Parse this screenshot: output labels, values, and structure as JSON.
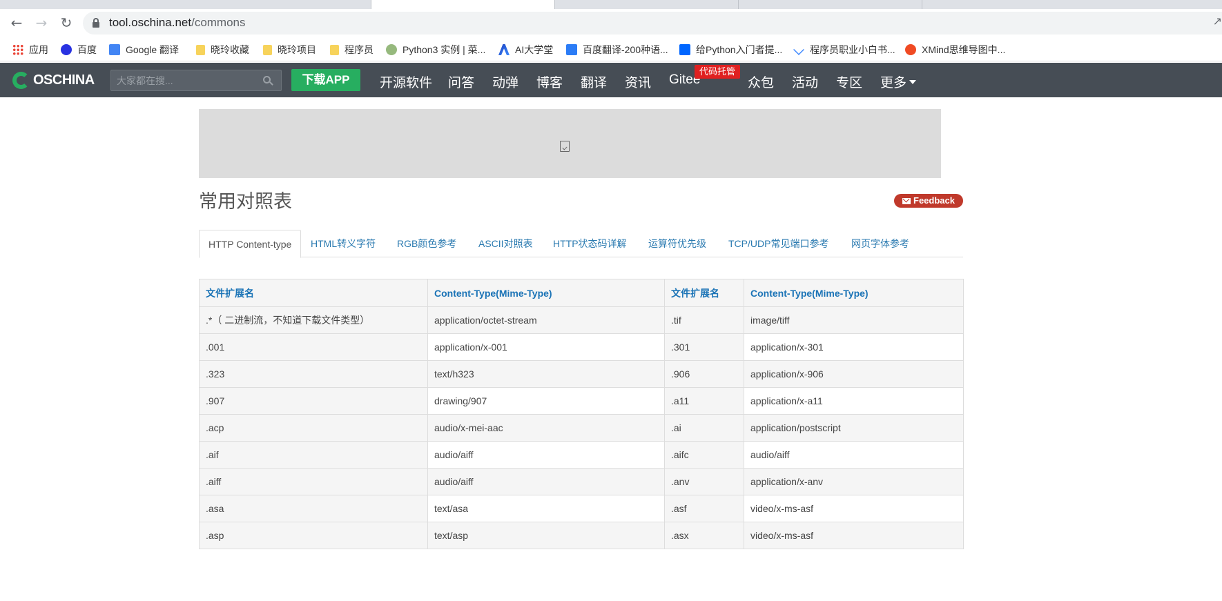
{
  "browser": {
    "address": {
      "host": "tool.oschina.net",
      "path": "/commons"
    },
    "bookmarks": [
      {
        "label": "应用",
        "icon": "apps-grid-icon"
      },
      {
        "label": "百度",
        "icon": "baidu-paw-icon"
      },
      {
        "label": "Google 翻译",
        "icon": "google-translate-icon"
      },
      {
        "label": "晓玲收藏",
        "icon": "folder-icon"
      },
      {
        "label": "晓玲项目",
        "icon": "folder-icon"
      },
      {
        "label": "程序员",
        "icon": "folder-icon"
      },
      {
        "label": "Python3 实例 | 菜...",
        "icon": "runoob-icon"
      },
      {
        "label": "AI大学堂",
        "icon": "ai-icon"
      },
      {
        "label": "百度翻译-200种语...",
        "icon": "baidu-translate-icon"
      },
      {
        "label": "给Python入门者提...",
        "icon": "zhihu-icon"
      },
      {
        "label": "程序员职业小白书...",
        "icon": "layers-icon"
      },
      {
        "label": "XMind思维导图中...",
        "icon": "xmind-icon"
      }
    ]
  },
  "header": {
    "logo_text": "OSCHINA",
    "search_placeholder": "大家都在搜...",
    "download_label": "下载APP",
    "nav": [
      "开源软件",
      "问答",
      "动弹",
      "博客",
      "翻译",
      "资讯",
      "Gitee",
      "众包",
      "活动",
      "专区",
      "更多"
    ],
    "gitee_badge": "代码托管"
  },
  "page": {
    "title": "常用对照表",
    "feedback_label": "Feedback",
    "tabs": [
      "HTTP Content-type",
      "HTML转义字符",
      "RGB颜色参考",
      "ASCII对照表",
      "HTTP状态码详解",
      "运算符优先级",
      "TCP/UDP常见端口参考",
      "网页字体参考"
    ]
  },
  "table": {
    "headers": [
      "文件扩展名",
      "Content-Type(Mime-Type)",
      "文件扩展名",
      "Content-Type(Mime-Type)"
    ],
    "rows": [
      [
        ".*（ 二进制流，不知道下载文件类型）",
        "application/octet-stream",
        ".tif",
        "image/tiff"
      ],
      [
        ".001",
        "application/x-001",
        ".301",
        "application/x-301"
      ],
      [
        ".323",
        "text/h323",
        ".906",
        "application/x-906"
      ],
      [
        ".907",
        "drawing/907",
        ".a11",
        "application/x-a11"
      ],
      [
        ".acp",
        "audio/x-mei-aac",
        ".ai",
        "application/postscript"
      ],
      [
        ".aif",
        "audio/aiff",
        ".aifc",
        "audio/aiff"
      ],
      [
        ".aiff",
        "audio/aiff",
        ".anv",
        "application/x-anv"
      ],
      [
        ".asa",
        "text/asa",
        ".asf",
        "video/x-ms-asf"
      ],
      [
        ".asp",
        "text/asp",
        ".asx",
        "video/x-ms-asf"
      ]
    ]
  },
  "colors": {
    "header_bg": "#464d55",
    "brand_green": "#27ae60",
    "link_blue": "#2a7ab0",
    "badge_red": "#e02020"
  }
}
